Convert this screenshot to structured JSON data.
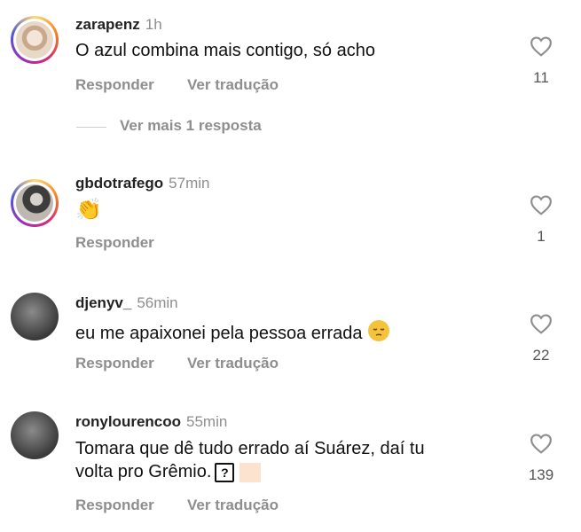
{
  "comments": [
    {
      "username": "zarapenz",
      "time": "1h",
      "text": "O azul combina mais contigo, só acho",
      "likes": "11",
      "actions": {
        "reply": "Responder",
        "translate": "Ver tradução"
      },
      "more_replies": "Ver mais 1 resposta"
    },
    {
      "username": "gbdotrafego",
      "time": "57min",
      "text": "👏",
      "likes": "1",
      "actions": {
        "reply": "Responder"
      }
    },
    {
      "username": "djenyv_",
      "time": "56min",
      "text": "eu me apaixonei pela pessoa errada",
      "emoji": "pensive-face",
      "likes": "22",
      "actions": {
        "reply": "Responder",
        "translate": "Ver tradução"
      }
    },
    {
      "username": "ronylourencoo",
      "time": "55min",
      "text_line1": "Tomara que dê tudo errado aí Suárez, daí tu",
      "text_line2": "volta pro Grêmio.",
      "unknown_glyph": "?",
      "likes": "139",
      "actions": {
        "reply": "Responder",
        "translate": "Ver tradução"
      }
    }
  ],
  "icons": {
    "like": "heart-outline-icon"
  }
}
